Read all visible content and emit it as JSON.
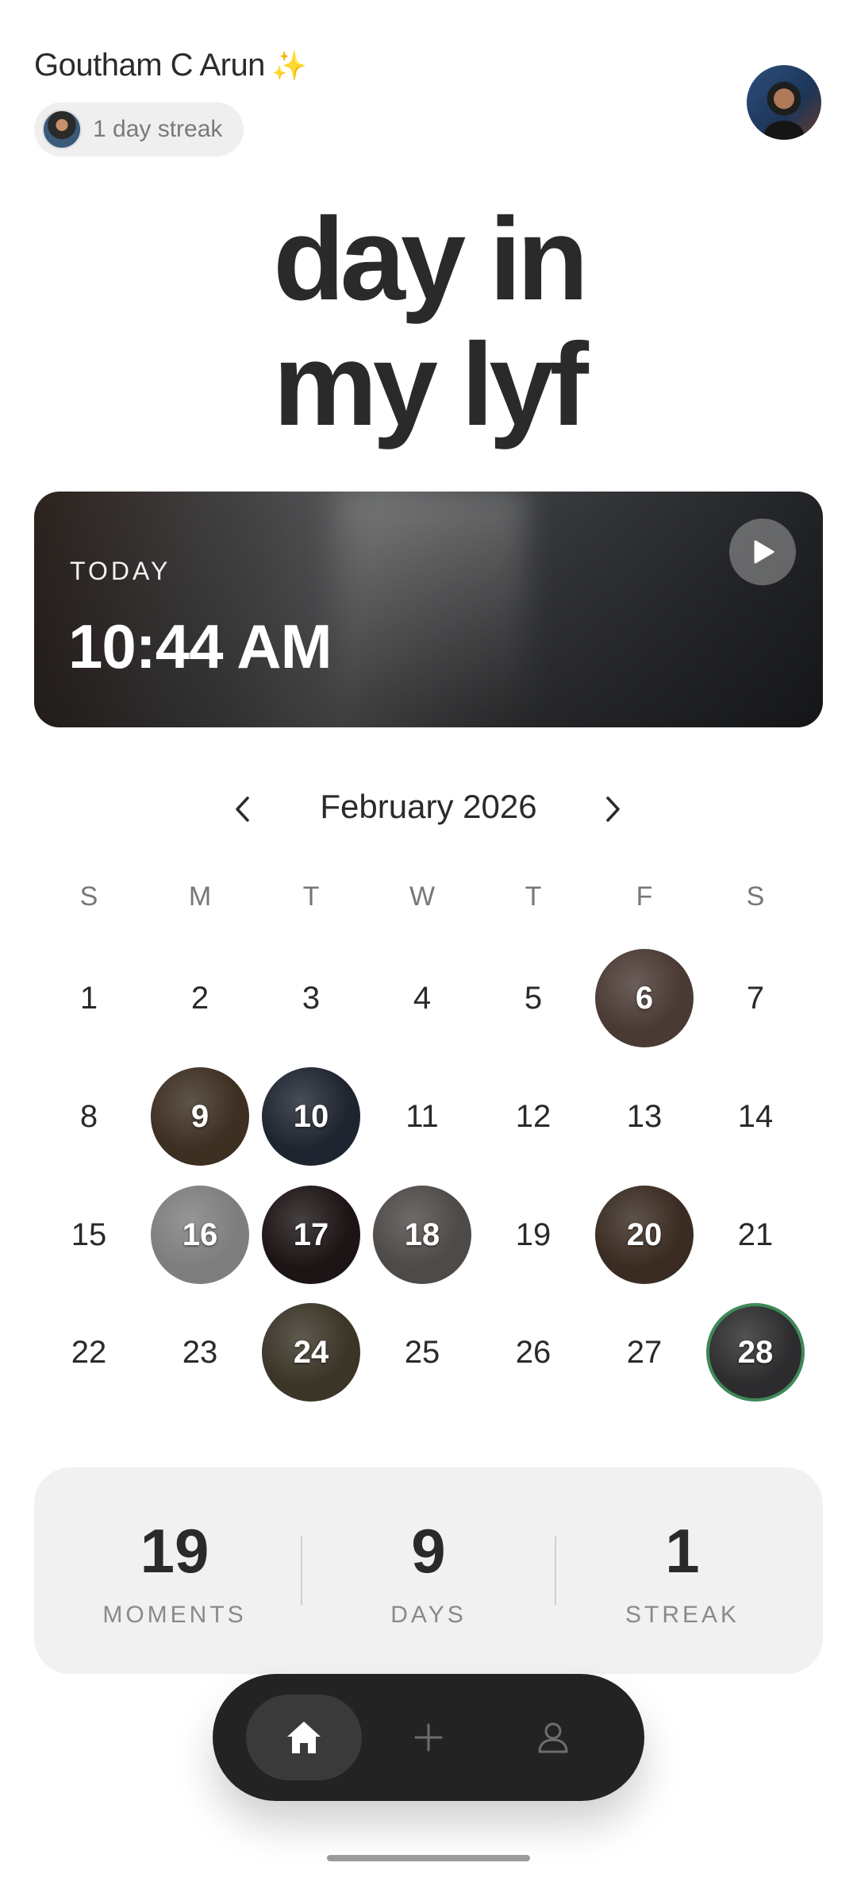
{
  "header": {
    "user_name": "Goutham C Arun",
    "user_icon": "sparkles-icon",
    "streak_label": "1 day streak"
  },
  "hero": {
    "line1": "day in",
    "line2": "my lyf"
  },
  "today_card": {
    "label": "TODAY",
    "time": "10:44 AM",
    "play_icon": "play-icon"
  },
  "calendar": {
    "month_title": "February 2026",
    "weekdays": [
      "S",
      "M",
      "T",
      "W",
      "T",
      "F",
      "S"
    ],
    "days": [
      {
        "day": "1"
      },
      {
        "day": "2"
      },
      {
        "day": "3"
      },
      {
        "day": "4"
      },
      {
        "day": "5"
      },
      {
        "day": "6",
        "photo": true,
        "tone": "#4a3a34"
      },
      {
        "day": "7"
      },
      {
        "day": "8"
      },
      {
        "day": "9",
        "photo": true,
        "tone": "#3d2f22"
      },
      {
        "day": "10",
        "photo": true,
        "tone": "#1f2530"
      },
      {
        "day": "11"
      },
      {
        "day": "12"
      },
      {
        "day": "13"
      },
      {
        "day": "14"
      },
      {
        "day": "15"
      },
      {
        "day": "16",
        "photo": true,
        "tone": "#7e7e7e"
      },
      {
        "day": "17",
        "photo": true,
        "tone": "#1d1515"
      },
      {
        "day": "18",
        "photo": true,
        "tone": "#4e4a48"
      },
      {
        "day": "19"
      },
      {
        "day": "20",
        "photo": true,
        "tone": "#3a2c22"
      },
      {
        "day": "21"
      },
      {
        "day": "22"
      },
      {
        "day": "23"
      },
      {
        "day": "24",
        "photo": true,
        "tone": "#3b3528"
      },
      {
        "day": "25"
      },
      {
        "day": "26"
      },
      {
        "day": "27"
      },
      {
        "day": "28",
        "photo": true,
        "tone": "#2c2c2e",
        "selected": true
      }
    ]
  },
  "stats": [
    {
      "value": "19",
      "label": "MOMENTS"
    },
    {
      "value": "9",
      "label": "DAYS"
    },
    {
      "value": "1",
      "label": "STREAK"
    }
  ],
  "tab_bar": {
    "tabs": [
      {
        "icon": "home-icon",
        "active": true
      },
      {
        "icon": "plus-icon",
        "active": false
      },
      {
        "icon": "profile-icon",
        "active": false
      }
    ]
  },
  "colors": {
    "accent_selected_ring": "#3f8a57",
    "tab_bar_bg": "#232323",
    "stats_bg": "#f1f1f1"
  }
}
